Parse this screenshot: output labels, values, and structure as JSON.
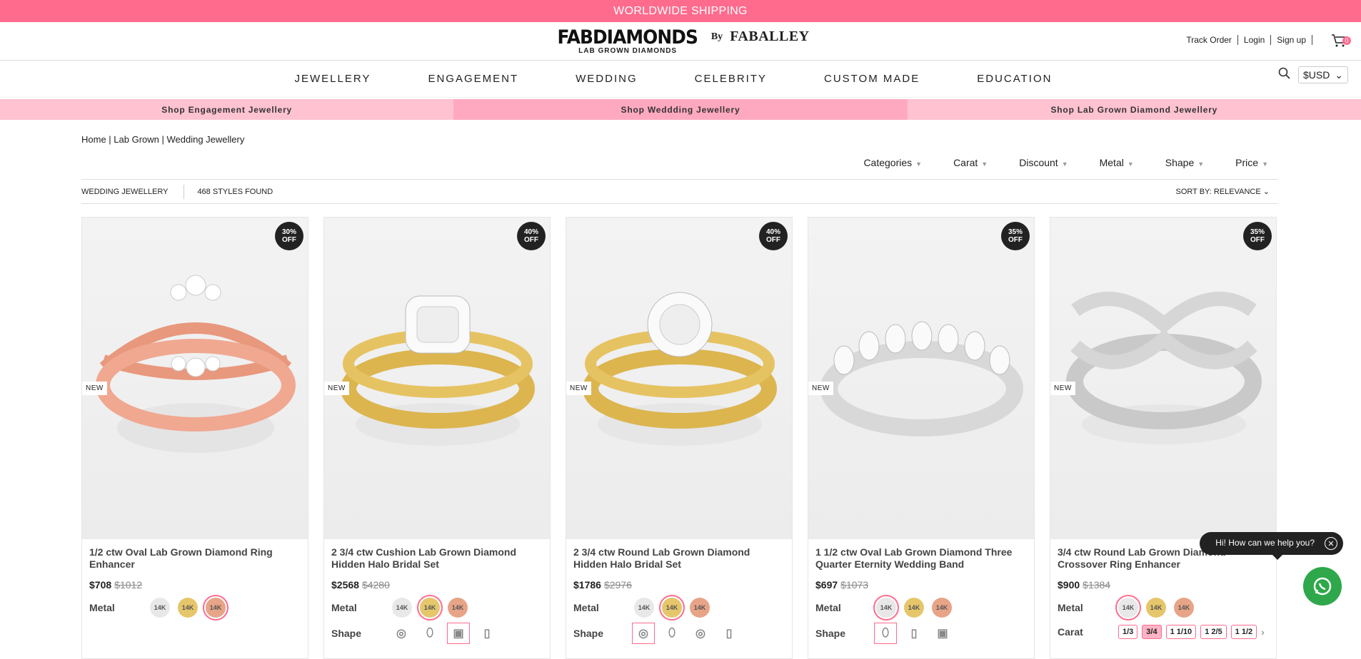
{
  "topbar": {
    "text": "WORLDWIDE SHIPPING"
  },
  "logo": {
    "main": "FABDIAMONDS",
    "sub": "LAB GROWN DIAMONDS",
    "by": "By",
    "brand": "FABALLEY"
  },
  "user_links": {
    "track": "Track Order",
    "login": "Login",
    "signup": "Sign up",
    "cart_count": "0"
  },
  "nav": {
    "items": [
      "JEWELLERY",
      "ENGAGEMENT",
      "WEDDING",
      "CELEBRITY",
      "CUSTOM MADE",
      "EDUCATION"
    ],
    "currency": "$USD"
  },
  "shopbar": {
    "left": "Shop Engagement Jewellery",
    "center": "Shop Weddding Jewellery",
    "right": "Shop Lab Grown Diamond Jewellery"
  },
  "breadcrumb": "Home | Lab Grown | Wedding Jewellery",
  "filters": [
    "Categories",
    "Carat",
    "Discount",
    "Metal",
    "Shape",
    "Price"
  ],
  "countbar": {
    "category": "WEDDING JEWELLERY",
    "found": "468 STYLES FOUND",
    "sort": "SORT BY: RELEVANCE"
  },
  "labels": {
    "metal": "Metal",
    "shape": "Shape",
    "carat": "Carat",
    "new": "NEW",
    "metal_14k": "14K"
  },
  "products": [
    {
      "title": "1/2 ctw Oval Lab Grown Diamond Ring Enhancer",
      "price": "$708",
      "old": "$1012",
      "badge_pct": "30%",
      "badge_off": "OFF"
    },
    {
      "title": "2 3/4 ctw Cushion Lab Grown Diamond Hidden Halo Bridal Set",
      "price": "$2568",
      "old": "$4280",
      "badge_pct": "40%",
      "badge_off": "OFF"
    },
    {
      "title": "2 3/4 ctw Round Lab Grown Diamond Hidden Halo Bridal Set",
      "price": "$1786",
      "old": "$2976",
      "badge_pct": "40%",
      "badge_off": "OFF"
    },
    {
      "title": "1 1/2 ctw Oval Lab Grown Diamond Three Quarter Eternity Wedding Band",
      "price": "$697",
      "old": "$1073",
      "badge_pct": "35%",
      "badge_off": "OFF"
    },
    {
      "title": "3/4 ctw Round Lab Grown Diamond Crossover Ring Enhancer",
      "price": "$900",
      "old": "$1384",
      "badge_pct": "35%",
      "badge_off": "OFF"
    }
  ],
  "carats": [
    "1/3",
    "3/4",
    "1 1/10",
    "1 2/5",
    "1 1/2"
  ],
  "chat": {
    "text": "Hi! How can we help you?"
  },
  "colors": {
    "accent": "#ff6b8d",
    "whatsapp": "#2ea84a"
  }
}
